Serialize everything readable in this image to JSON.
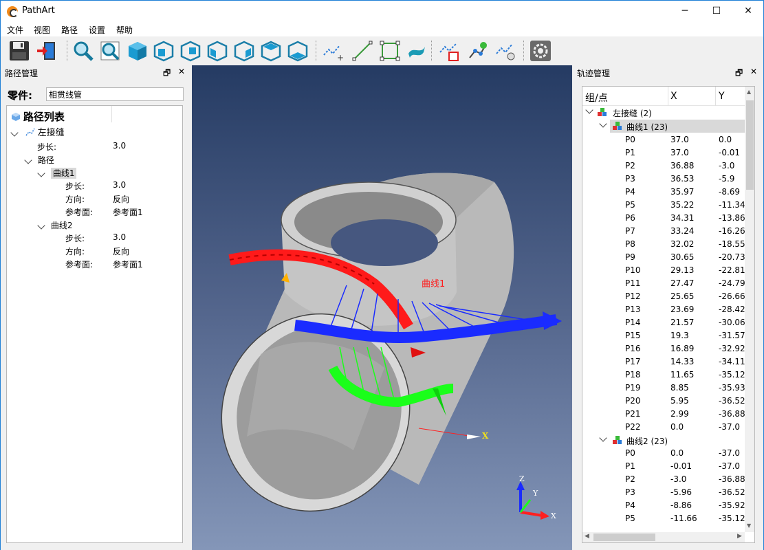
{
  "app": {
    "title": "PathArt",
    "minimize": "─",
    "maximize": "☐",
    "close": "✕"
  },
  "menu": [
    "文件",
    "视图",
    "路径",
    "设置",
    "帮助"
  ],
  "toolbar": {
    "icons": [
      "save-icon",
      "exit-icon",
      "zoom-icon",
      "zoom-fit-icon",
      "iso-view-icon",
      "front-view-icon",
      "back-view-icon",
      "left-view-icon",
      "right-view-icon",
      "top-view-icon",
      "bottom-view-icon",
      "add-path-icon",
      "line-icon",
      "rect-icon",
      "surface-icon",
      "path-edit-icon",
      "path-settings-icon",
      "path-export-icon",
      "settings-gear-icon"
    ]
  },
  "left_panel": {
    "title": "路径管理",
    "float": "🗗",
    "close": "✕",
    "part_label": "零件:",
    "part_value": "相贯线管",
    "tree": {
      "root": "路径列表",
      "group": "左接缝",
      "step_label": "步长:",
      "step_value": "3.0",
      "path_label": "路径",
      "curves": [
        {
          "name": "曲线1",
          "step_label": "步长:",
          "step_value": "3.0",
          "dir_label": "方向:",
          "dir_value": "反向",
          "ref_label": "参考面:",
          "ref_value": "参考面1"
        },
        {
          "name": "曲线2",
          "step_label": "步长:",
          "step_value": "3.0",
          "dir_label": "方向:",
          "dir_value": "反向",
          "ref_label": "参考面:",
          "ref_value": "参考面1"
        }
      ]
    }
  },
  "viewport": {
    "curve_label": "曲线1",
    "axis_x": "X",
    "axis_y": "Y",
    "axis_z": "Z",
    "tri_x": "X",
    "colors": {
      "red": "#ff1a1a",
      "blue": "#1a2bff",
      "green": "#1aff1a"
    }
  },
  "right_panel": {
    "title": "轨迹管理",
    "float": "🗗",
    "close": "✕",
    "columns": [
      "组/点",
      "X",
      "Y"
    ],
    "group": "左接缝 (2)",
    "curve1": "曲线1 (23)",
    "curve1_points": [
      [
        "P0",
        "37.0",
        "0.0"
      ],
      [
        "P1",
        "37.0",
        "-0.01"
      ],
      [
        "P2",
        "36.88",
        "-3.0"
      ],
      [
        "P3",
        "36.53",
        "-5.9"
      ],
      [
        "P4",
        "35.97",
        "-8.69"
      ],
      [
        "P5",
        "35.22",
        "-11.34"
      ],
      [
        "P6",
        "34.31",
        "-13.86"
      ],
      [
        "P7",
        "33.24",
        "-16.26"
      ],
      [
        "P8",
        "32.02",
        "-18.55"
      ],
      [
        "P9",
        "30.65",
        "-20.73"
      ],
      [
        "P10",
        "29.13",
        "-22.81"
      ],
      [
        "P11",
        "27.47",
        "-24.79"
      ],
      [
        "P12",
        "25.65",
        "-26.66"
      ],
      [
        "P13",
        "23.69",
        "-28.42"
      ],
      [
        "P14",
        "21.57",
        "-30.06"
      ],
      [
        "P15",
        "19.3",
        "-31.57"
      ],
      [
        "P16",
        "16.89",
        "-32.92"
      ],
      [
        "P17",
        "14.33",
        "-34.11"
      ],
      [
        "P18",
        "11.65",
        "-35.12"
      ],
      [
        "P19",
        "8.85",
        "-35.93"
      ],
      [
        "P20",
        "5.95",
        "-36.52"
      ],
      [
        "P21",
        "2.99",
        "-36.88"
      ],
      [
        "P22",
        "0.0",
        "-37.0"
      ]
    ],
    "curve2": "曲线2 (23)",
    "curve2_points": [
      [
        "P0",
        "0.0",
        "-37.0"
      ],
      [
        "P1",
        "-0.01",
        "-37.0"
      ],
      [
        "P2",
        "-3.0",
        "-36.88"
      ],
      [
        "P3",
        "-5.96",
        "-36.52"
      ],
      [
        "P4",
        "-8.86",
        "-35.92"
      ],
      [
        "P5",
        "-11.66",
        "-35.12"
      ]
    ]
  }
}
